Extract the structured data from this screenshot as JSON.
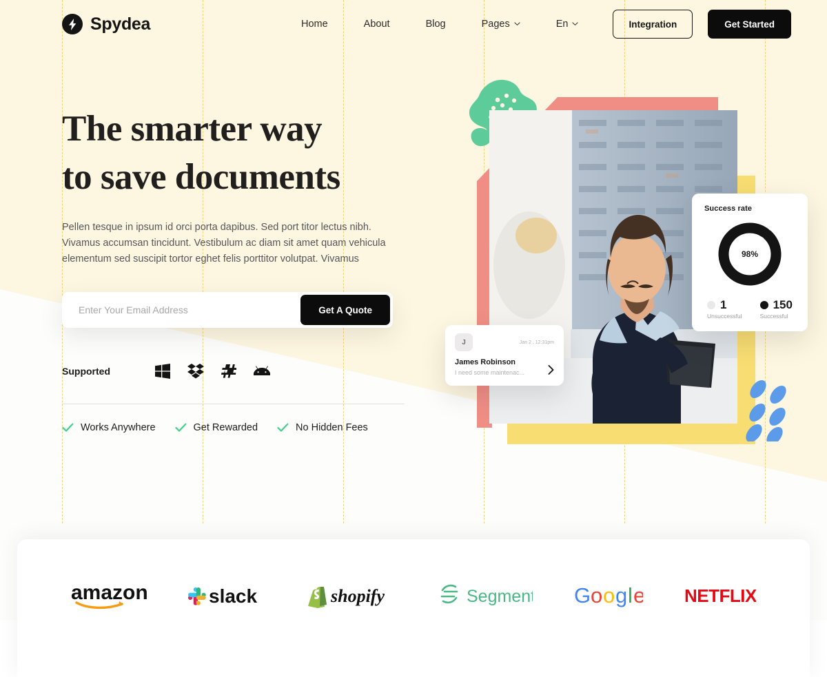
{
  "brand": {
    "name": "Spydea",
    "mark_icon": "lightning-bolt-icon"
  },
  "nav": {
    "links": [
      {
        "label": "Home",
        "has_caret": false
      },
      {
        "label": "About",
        "has_caret": false
      },
      {
        "label": "Blog",
        "has_caret": false
      },
      {
        "label": "Pages",
        "has_caret": true
      },
      {
        "label": "En",
        "has_caret": true
      }
    ],
    "integration_label": "Integration",
    "get_started_label": "Get Started"
  },
  "hero": {
    "title_line1": "The smarter way",
    "title_line2": "to save documents",
    "paragraph": "Pellen tesque in ipsum id orci porta dapibus. Sed port titor lectus nibh. Vivamus accumsan tincidunt. Vestibulum ac diam sit amet quam vehicula elementum sed suscipit tortor eghet felis porttitor volutpat. Vivamus",
    "email_placeholder": "Enter Your Email Address",
    "email_value": "",
    "quote_label": "Get A Quote",
    "supported_label": "Supported",
    "supported_icons": [
      "windows-icon",
      "dropbox-icon",
      "slack-hash-icon",
      "android-icon"
    ],
    "features": [
      {
        "label": "Works Anywhere",
        "icon": "check-icon"
      },
      {
        "label": "Get Rewarded",
        "icon": "check-icon"
      },
      {
        "label": "No Hidden Fees",
        "icon": "check-icon"
      }
    ]
  },
  "success_card": {
    "title": "Success rate",
    "center_value": "98%",
    "legend": [
      {
        "value": "1",
        "name": "Unsuccessful",
        "color": "#e9e9e9"
      },
      {
        "value": "150",
        "name": "Successful",
        "color": "#141414"
      }
    ]
  },
  "message_card": {
    "avatar_initial": "J",
    "timestamp": "Jan 2 , 12:31pm",
    "sender": "James Robinson",
    "preview": "I need some maintenac...",
    "arrow_icon": "chevron-right-icon"
  },
  "brands": [
    {
      "name": "amazon",
      "icon": "amazon-logo"
    },
    {
      "name": "slack",
      "icon": "slack-logo"
    },
    {
      "name": "shopify",
      "icon": "shopify-logo"
    },
    {
      "name": "Segment",
      "icon": "segment-logo"
    },
    {
      "name": "Google",
      "icon": "google-logo"
    },
    {
      "name": "NETFLIX",
      "icon": "netflix-logo"
    }
  ],
  "chart_data": {
    "type": "pie",
    "title": "Success rate",
    "categories": [
      "Successful",
      "Unsuccessful"
    ],
    "values": [
      150,
      1
    ],
    "percentages": [
      98,
      2
    ],
    "colors": [
      "#141414",
      "#e9e9e9"
    ],
    "center_label": "98%",
    "legend_position": "bottom"
  },
  "colors": {
    "cream": "#fdf6e0",
    "guide": "#ecce6a",
    "dark": "#0c0c0c",
    "pink": "#f08e85",
    "green": "#5ecb9b",
    "yellow": "#f8dd72",
    "blue": "#5b9bea",
    "check_green": "#3ed18b"
  }
}
